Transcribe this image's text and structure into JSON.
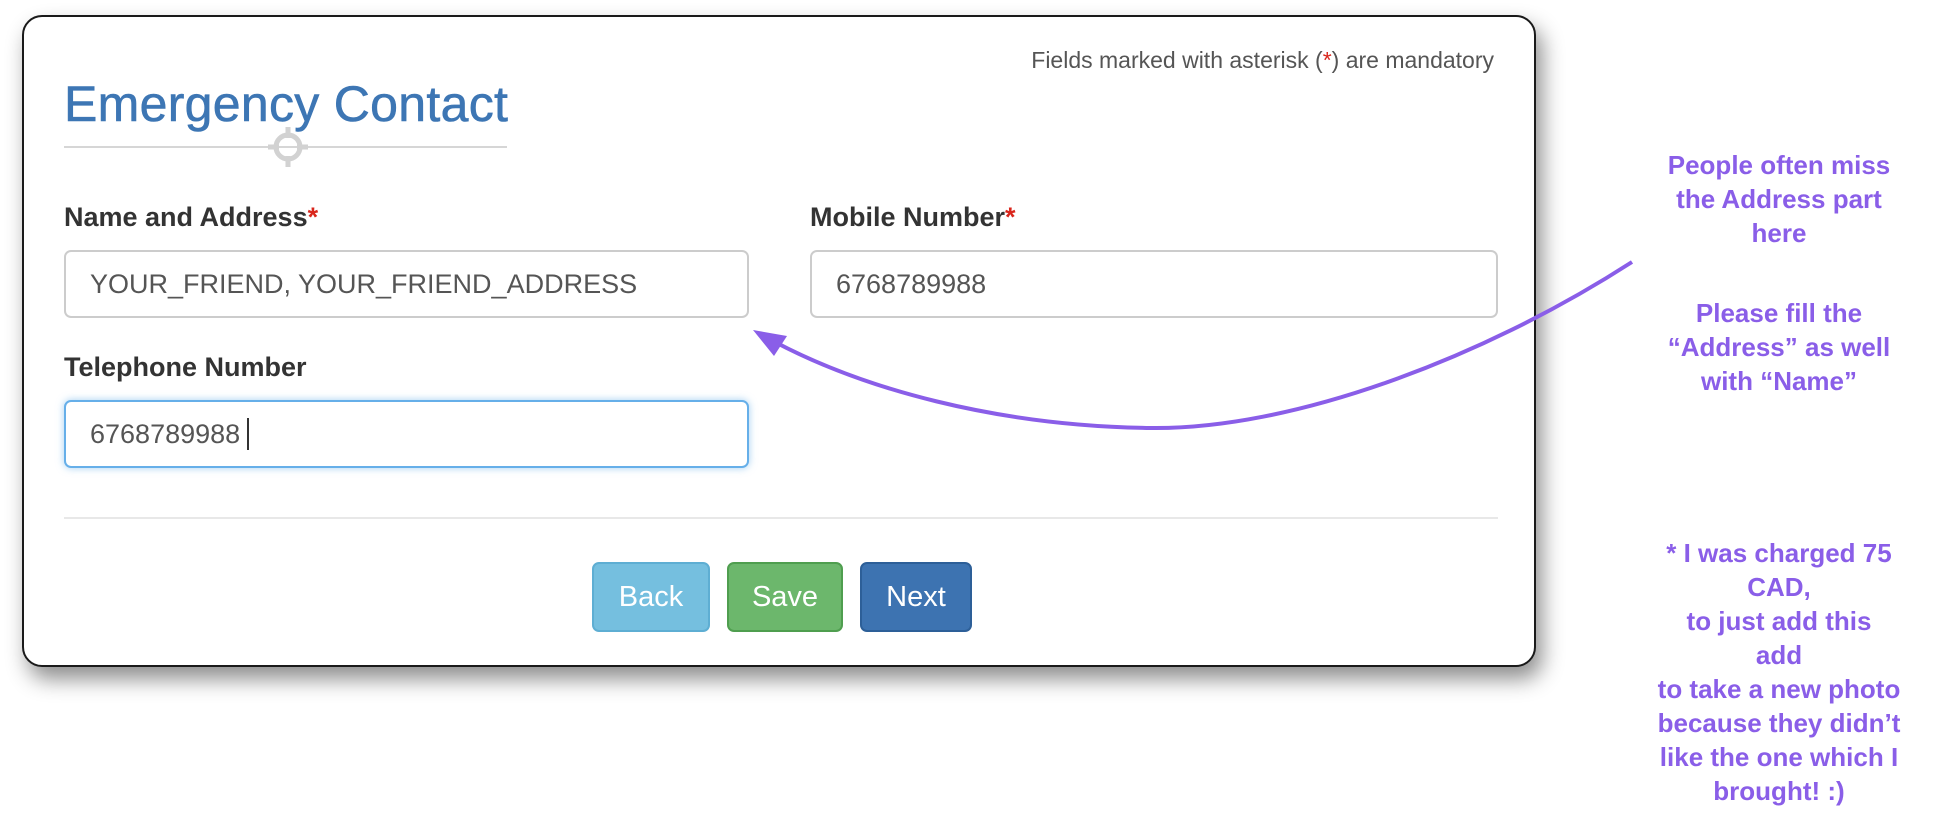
{
  "form": {
    "mandatory_note_prefix": "Fields marked with asterisk (",
    "mandatory_note_asterisk": "*",
    "mandatory_note_suffix": ") are mandatory",
    "title": "Emergency Contact",
    "required_marker": "*",
    "fields": {
      "name_address": {
        "label": "Name and Address",
        "value": "YOUR_FRIEND, YOUR_FRIEND_ADDRESS",
        "required": true
      },
      "mobile": {
        "label": "Mobile Number",
        "value": "6768789988",
        "required": true
      },
      "telephone": {
        "label": "Telephone Number",
        "value": "6768789988",
        "required": false,
        "focused": true
      }
    },
    "buttons": {
      "back": "Back",
      "save": "Save",
      "next": "Next"
    }
  },
  "annotation": {
    "note_1": "People often miss\nthe Address part\nhere",
    "note_2": "Please fill the\n“Address” as well\nwith “Name”",
    "note_3": "* I was charged 75\nCAD,\nto just add this\nadd\nto take a new photo\nbecause they didn’t\nlike the one which I\nbrought! :)"
  },
  "colors": {
    "title_blue": "#3d76b4",
    "required_red": "#d9261c",
    "annotation_purple": "#8a5ee8",
    "back_button": "#75bfdf",
    "save_button": "#6cb76c",
    "next_button": "#3d73b1",
    "focus_border": "#66afe9"
  },
  "icons": {
    "title_crosshair": "crosshair-icon",
    "annotation_arrow": "arrow-icon"
  }
}
